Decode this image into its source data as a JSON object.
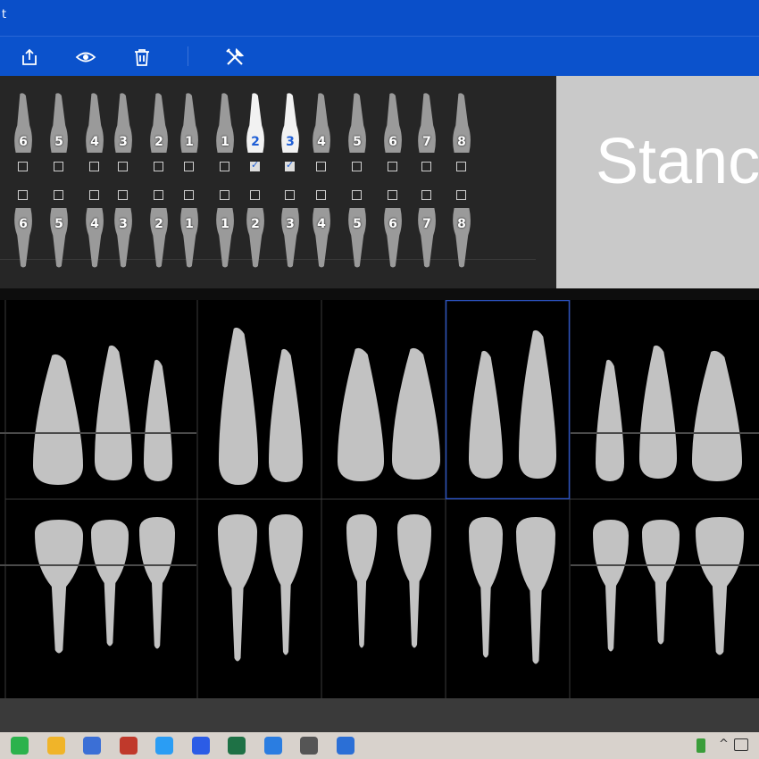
{
  "window": {
    "title": "t"
  },
  "toolbar": {
    "buttons": [
      {
        "icon": "share-icon"
      },
      {
        "icon": "eye-icon"
      },
      {
        "icon": "trash-icon"
      },
      {
        "icon": "tools-icon"
      }
    ]
  },
  "upper_row": {
    "numbers": [
      "6",
      "5",
      "4",
      "3",
      "2",
      "1",
      "1",
      "2",
      "3",
      "4",
      "5",
      "6",
      "7",
      "8"
    ],
    "checked": [
      false,
      false,
      false,
      false,
      false,
      false,
      false,
      true,
      true,
      false,
      false,
      false,
      false,
      false
    ]
  },
  "lower_row": {
    "numbers": [
      "6",
      "5",
      "4",
      "3",
      "2",
      "1",
      "1",
      "2",
      "3",
      "4",
      "5",
      "6",
      "7",
      "8"
    ],
    "checked": [
      false,
      false,
      false,
      false,
      false,
      false,
      false,
      false,
      false,
      false,
      false,
      false,
      false,
      false
    ]
  },
  "preview": {
    "text": "Stanc"
  },
  "colors": {
    "accent": "#0b52cc",
    "selection": "#1f5fd6"
  },
  "taskbar": {
    "apps": [
      "wechat-icon",
      "folder-icon",
      "wps-writer-icon",
      "network-icon",
      "cloud-icon",
      "todo-icon",
      "excel-icon",
      "dice-icon",
      "search-app-icon",
      "dental-app-icon"
    ]
  }
}
